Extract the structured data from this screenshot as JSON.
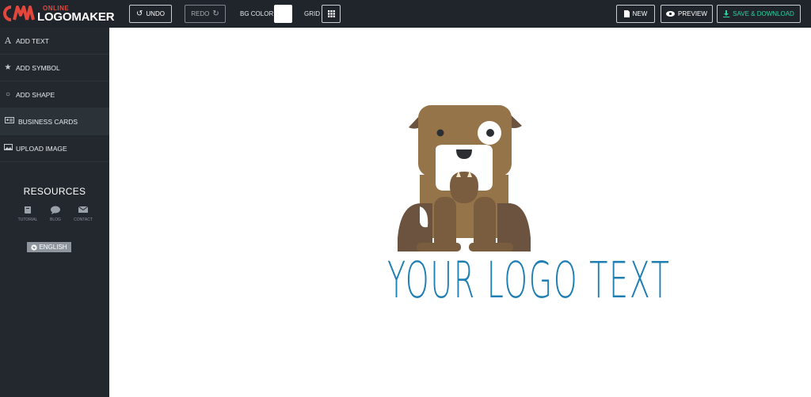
{
  "brand": {
    "online": "ONLINE",
    "name": "LOGOMAKER"
  },
  "toolbar": {
    "undo": "UNDO",
    "redo": "REDO",
    "bg_color": "BG COLOR",
    "grid": "GRID",
    "new": "NEW",
    "preview": "PREVIEW",
    "save": "SAVE & DOWNLOAD"
  },
  "sidebar": {
    "items": [
      {
        "label": "ADD TEXT",
        "icon": "text-icon"
      },
      {
        "label": "ADD SYMBOL",
        "icon": "star-icon"
      },
      {
        "label": "ADD SHAPE",
        "icon": "circle-icon"
      },
      {
        "label": "BUSINESS CARDS",
        "icon": "id-card-icon"
      },
      {
        "label": "UPLOAD IMAGE",
        "icon": "image-icon"
      }
    ],
    "resources_title": "RESOURCES",
    "resources": [
      {
        "label": "TUTORIAL",
        "icon": "book-icon"
      },
      {
        "label": "BLOG",
        "icon": "chat-icon"
      },
      {
        "label": "CONTACT",
        "icon": "envelope-icon"
      }
    ],
    "language": "ENGLISH"
  },
  "canvas": {
    "logo_text": "YOUR LOGO TEXT",
    "bg_color": "#ffffff",
    "text_color": "#1f7fb4"
  }
}
